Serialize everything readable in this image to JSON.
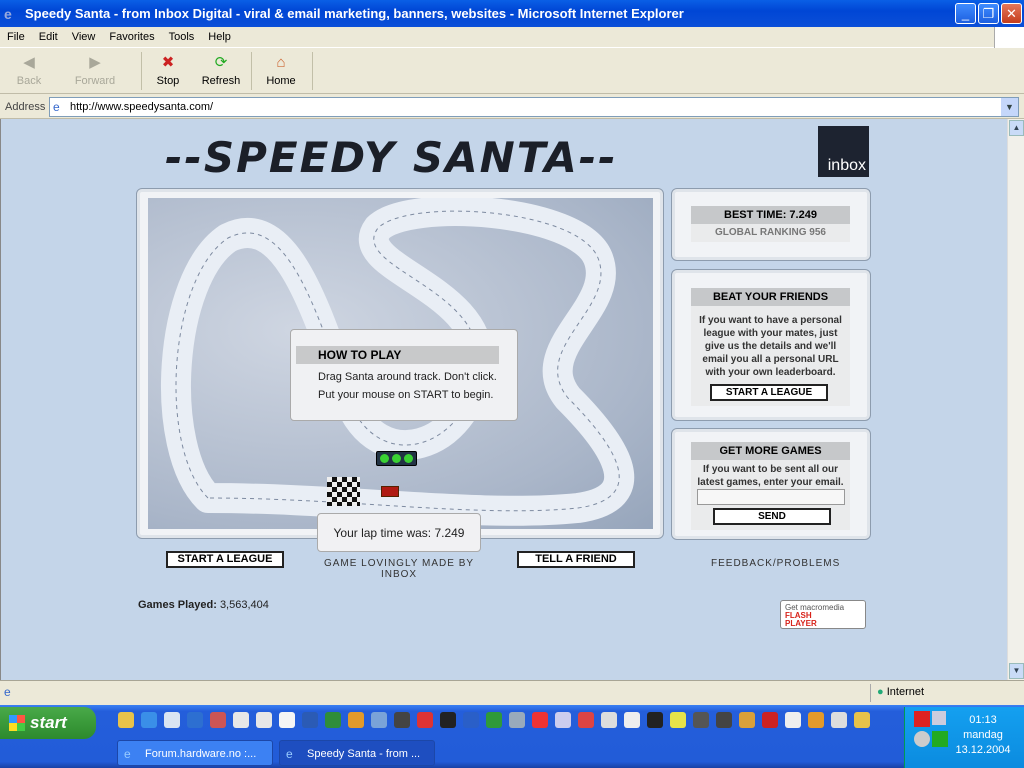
{
  "window": {
    "title": "Speedy Santa - from Inbox Digital - viral & email marketing, banners, websites - Microsoft Internet Explorer"
  },
  "menu": [
    "File",
    "Edit",
    "View",
    "Favorites",
    "Tools",
    "Help"
  ],
  "toolbar": {
    "back": "Back",
    "forward": "Forward",
    "stop": "Stop",
    "refresh": "Refresh",
    "home": "Home"
  },
  "address": {
    "label": "Address",
    "url": "http://www.speedysanta.com/"
  },
  "page": {
    "logo_text": "--SPEEDY SANTA--",
    "brand": "inbox",
    "howto_title": "HOW TO PLAY",
    "howto_line1": "Drag Santa around track. Don't click.",
    "howto_line2": "Put your mouse on START to begin.",
    "lap_time": "Your lap time was: 7.249",
    "start_league": "START A LEAGUE",
    "made_by": "GAME LOVINGLY MADE BY INBOX",
    "tell_friend": "TELL A FRIEND",
    "best_time": "BEST TIME: 7.249",
    "global_ranking": "GLOBAL RANKING 956",
    "beat_title": "BEAT YOUR FRIENDS",
    "beat_text": "If you want to have a personal league with your mates, just give us the details and we'll email you all a personal URL with your own leaderboard.",
    "beat_button": "START A LEAGUE",
    "more_title": "GET MORE GAMES",
    "more_text": "If you want to be sent all our latest games, enter your email.",
    "send_button": "SEND",
    "feedback": "FEEDBACK/PROBLEMS",
    "games_played_label": "Games Played:",
    "games_played_value": "3,563,404",
    "flash_line1": "Get macromedia",
    "flash_line2": "FLASH",
    "flash_line3": "PLAYER"
  },
  "status": {
    "zone": "Internet"
  },
  "taskbar": {
    "start": "start",
    "tasks": [
      "Forum.hardware.no :...",
      "Speedy Santa - from ..."
    ],
    "time": "01:13",
    "day": "mandag",
    "date": "13.12.2004"
  }
}
